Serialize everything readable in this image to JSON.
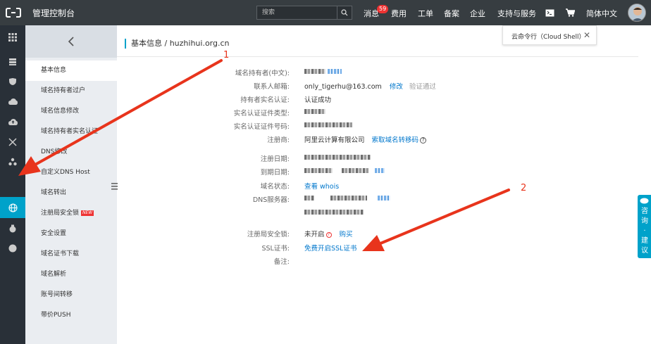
{
  "topbar": {
    "brand": "管理控制台",
    "search_placeholder": "搜索",
    "messages_label": "消息",
    "messages_count": "59",
    "nav": [
      "费用",
      "工单",
      "备案",
      "企业",
      "支持与服务"
    ],
    "language": "简体中文"
  },
  "cloud_shell": {
    "label": "云命令行（Cloud Shell）",
    "close": "✕"
  },
  "subnav": {
    "items": [
      {
        "label": "基本信息",
        "active": true
      },
      {
        "label": "域名持有者过户"
      },
      {
        "label": "域名信息修改"
      },
      {
        "label": "域名持有者实名认证"
      },
      {
        "label": "DNS修改"
      },
      {
        "label": "自定义DNS Host"
      },
      {
        "label": "域名转出"
      },
      {
        "label": "注册局安全锁",
        "tag": "NEW"
      },
      {
        "label": "安全设置"
      },
      {
        "label": "域名证书下载"
      },
      {
        "label": "域名解析"
      },
      {
        "label": "账号间转移"
      },
      {
        "label": "带价PUSH"
      }
    ]
  },
  "main": {
    "breadcrumb": "基本信息 / huzhihui.org.cn",
    "fields": {
      "owner_cn_label": "域名持有者(中文):",
      "email_label": "联系人邮箱:",
      "email_value": "only_tigerhu@163.com",
      "email_edit": "修改",
      "email_status": "验证通过",
      "realname_label": "持有者实名认证:",
      "realname_value": "认证成功",
      "cert_type_label": "实名认证证件类型:",
      "cert_no_label": "实名认证证件号码:",
      "registrar_label": "注册商:",
      "registrar_value": "阿里云计算有限公司",
      "transfer_code": "索取域名转移码",
      "reg_date_label": "注册日期:",
      "exp_date_label": "到期日期:",
      "status_label": "域名状态:",
      "status_value": "查看 whois",
      "dns_label": "DNS服务器:",
      "lock_label": "注册局安全锁:",
      "lock_value": "未开启",
      "lock_buy": "购买",
      "ssl_label": "SSL证书:",
      "ssl_value": "免费开启SSL证书",
      "remark_label": "备注:"
    }
  },
  "consult": {
    "label": "咨询·建议"
  },
  "annotations": {
    "num1": "1",
    "num2": "2"
  },
  "colors": {
    "topbar_bg": "#373d41",
    "leftbar_bg": "#293038",
    "accent": "#00a2ca",
    "subnav_bg": "#eaedf1",
    "link": "#0077cc",
    "arrow": "#e8341c"
  }
}
